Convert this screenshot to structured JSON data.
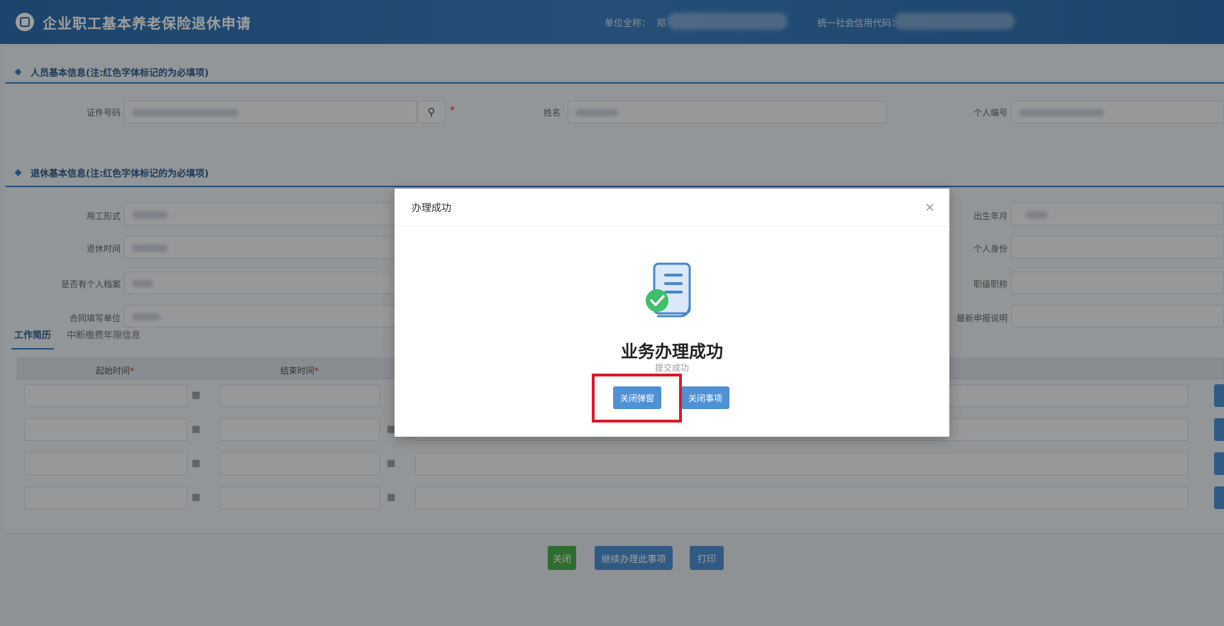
{
  "header": {
    "title": "企业职工基本养老保险退休申请",
    "unit_name_label": "单位全称：",
    "unit_name_value": "郑",
    "credit_code_label": "统一社会信用代码："
  },
  "sections": {
    "personal_info": "人员基本信息(注:红色字体标记的为必填项)",
    "retire_info": "退休基本信息(注:红色字体标记的为必填项)"
  },
  "personal_fields": {
    "id_number_label": "证件号码",
    "name_label": "姓名",
    "personal_no_label": "个人编号"
  },
  "retire_fields": {
    "employment_form_label": "用工形式",
    "retire_time_label": "退休时间",
    "has_archive_label": "是否有个人档案",
    "contract_unit_label": "合同填写单位",
    "birth_label": "出生年月",
    "identity_label": "个人身份",
    "title_label": "职级职称",
    "declare_label": "最新申报说明"
  },
  "tabs": [
    {
      "label": "工作简历",
      "active": true
    },
    {
      "label": "中断缴费年限信息",
      "active": false
    }
  ],
  "table": {
    "headers": [
      {
        "label": "起始时间",
        "required": true
      },
      {
        "label": "结束时间",
        "required": true
      }
    ],
    "required_mark": "*"
  },
  "footer_buttons": {
    "close": "关闭",
    "continue": "继续办理此事项",
    "print": "打印"
  },
  "modal": {
    "header": "办理成功",
    "close_glyph": "×",
    "title": "业务办理成功",
    "subtitle": "提交成功",
    "close_popup_button": "关闭弹窗",
    "close_item_button": "关闭事项"
  },
  "colors": {
    "primary": "#3b7fc0",
    "button_blue": "#4f91d4",
    "button_green": "#4cae4c",
    "highlight_red": "#d9192b",
    "required_red": "#e03030"
  }
}
